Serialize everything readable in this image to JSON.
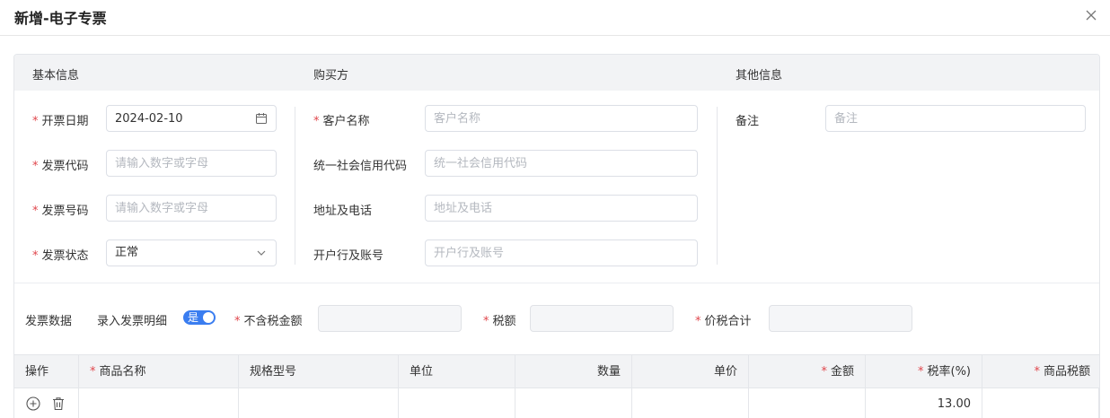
{
  "dialog": {
    "title": "新增-电子专票"
  },
  "sections": {
    "basic": "基本信息",
    "buyer": "购买方",
    "other": "其他信息"
  },
  "basic": {
    "invoice_date_label": "开票日期",
    "invoice_date_value": "2024-02-10",
    "invoice_code_label": "发票代码",
    "invoice_code_placeholder": "请输入数字或字母",
    "invoice_number_label": "发票号码",
    "invoice_number_placeholder": "请输入数字或字母",
    "invoice_status_label": "发票状态",
    "invoice_status_value": "正常"
  },
  "buyer": {
    "customer_name_label": "客户名称",
    "customer_name_placeholder": "客户名称",
    "credit_code_label": "统一社会信用代码",
    "credit_code_placeholder": "统一社会信用代码",
    "address_label": "地址及电话",
    "address_placeholder": "地址及电话",
    "bank_label": "开户行及账号",
    "bank_placeholder": "开户行及账号"
  },
  "other": {
    "remark_label": "备注",
    "remark_placeholder": "备注"
  },
  "invoice_data": {
    "label": "发票数据",
    "detail_toggle_label": "录入发票明细",
    "detail_toggle_value": "是",
    "amount_ex_tax_label": "不含税金额",
    "tax_label": "税额",
    "total_label": "价税合计"
  },
  "table": {
    "columns": [
      "操作",
      "商品名称",
      "规格型号",
      "单位",
      "数量",
      "单价",
      "金额",
      "税率(%)",
      "商品税额"
    ],
    "rows": [
      {
        "tax_rate": "13.00"
      }
    ]
  },
  "icons": {
    "close": "close-icon",
    "calendar": "calendar-icon",
    "dropdown": "chevron-down-icon",
    "add": "plus-circle-icon",
    "delete": "trash-icon"
  },
  "colors": {
    "required": "#e0464c",
    "toggle": "#3a7df0"
  }
}
